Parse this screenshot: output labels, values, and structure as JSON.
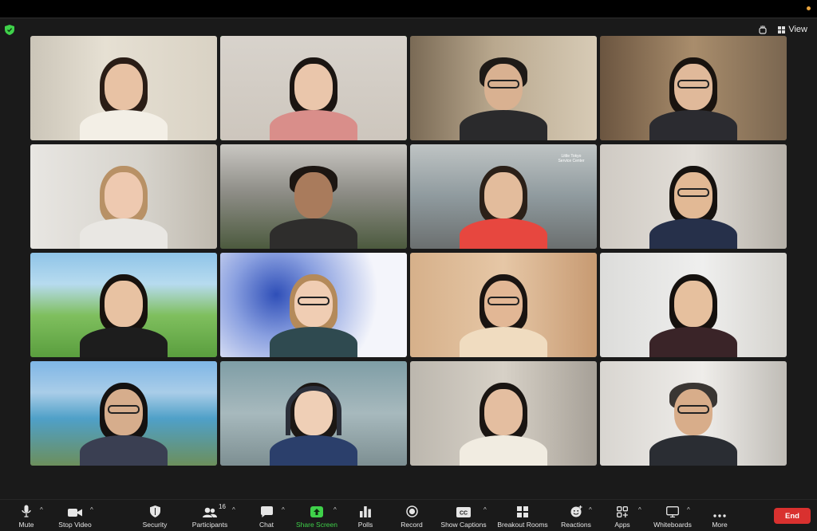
{
  "window": {
    "view_label": "View",
    "accent": "#3fd14a",
    "end_color": "#d9312f"
  },
  "participants_tiles": [
    {
      "id": 1,
      "speaking": false
    },
    {
      "id": 2,
      "speaking": true
    },
    {
      "id": 3,
      "speaking": false
    },
    {
      "id": 4,
      "speaking": false
    },
    {
      "id": 5,
      "speaking": false
    },
    {
      "id": 6,
      "speaking": false
    },
    {
      "id": 7,
      "speaking": false,
      "background_text": "Little Tokyo Service Center"
    },
    {
      "id": 8,
      "speaking": false
    },
    {
      "id": 9,
      "speaking": false
    },
    {
      "id": 10,
      "speaking": false
    },
    {
      "id": 11,
      "speaking": false
    },
    {
      "id": 12,
      "speaking": false
    },
    {
      "id": 13,
      "speaking": false
    },
    {
      "id": 14,
      "speaking": false
    },
    {
      "id": 15,
      "speaking": false
    },
    {
      "id": 16,
      "speaking": false
    }
  ],
  "toolbar": {
    "mute": "Mute",
    "stop_video": "Stop Video",
    "security": "Security",
    "participants": "Participants",
    "participants_count": "16",
    "chat": "Chat",
    "share_screen": "Share Screen",
    "polls": "Polls",
    "record": "Record",
    "show_captions": "Show Captions",
    "breakout_rooms": "Breakout Rooms",
    "reactions": "Reactions",
    "apps": "Apps",
    "whiteboards": "Whiteboards",
    "more": "More",
    "end": "End",
    "cc_icon_text": "CC"
  },
  "icons": [
    "shield-icon",
    "hand-icon",
    "grid-icon",
    "microphone-icon",
    "video-camera-icon",
    "security-shield-icon",
    "participants-icon",
    "chat-bubble-icon",
    "share-screen-icon",
    "polls-icon",
    "record-icon",
    "captions-icon",
    "breakout-rooms-icon",
    "reactions-icon",
    "apps-icon",
    "whiteboard-icon",
    "more-dots-icon"
  ]
}
